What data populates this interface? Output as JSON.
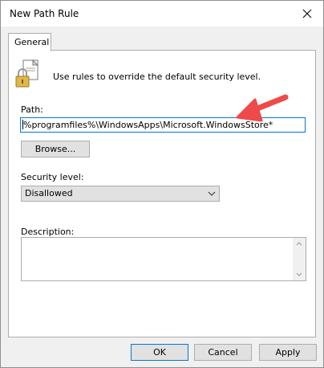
{
  "window": {
    "title": "New Path Rule"
  },
  "tabs": [
    {
      "label": "General"
    }
  ],
  "general": {
    "intro_text": "Use rules to override the default security level.",
    "path_label": "Path:",
    "path_value": "%programfiles%\\WindowsApps\\Microsoft.WindowsStore*",
    "browse_label": "Browse...",
    "security_level_label": "Security level:",
    "security_level_value": "Disallowed",
    "description_label": "Description:",
    "description_value": ""
  },
  "footer": {
    "ok_label": "OK",
    "cancel_label": "Cancel",
    "apply_label": "Apply"
  },
  "colors": {
    "accent": "#0078d7",
    "arrow": "#ee4a4a"
  },
  "icons": [
    "close-icon",
    "lock-icon",
    "chevron-down-icon",
    "scroll-up-icon",
    "scroll-down-icon",
    "red-arrow-annotation"
  ]
}
